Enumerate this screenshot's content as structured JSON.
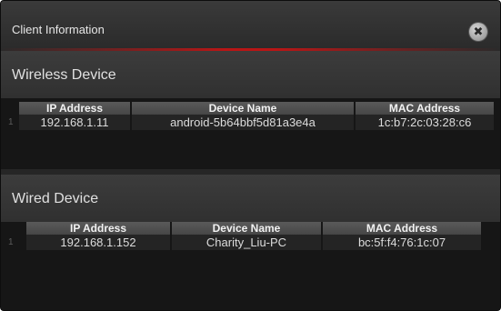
{
  "window": {
    "title": "Client Information"
  },
  "wireless": {
    "title": "Wireless Device",
    "columns": [
      "IP Address",
      "Device Name",
      "MAC Address"
    ],
    "rows": [
      {
        "num": "1",
        "ip": "192.168.1.11",
        "name": "android-5b64bbf5d81a3e4a",
        "mac": "1c:b7:2c:03:28:c6"
      }
    ]
  },
  "wired": {
    "title": "Wired Device",
    "columns": [
      "IP Address",
      "Device Name",
      "MAC Address"
    ],
    "rows": [
      {
        "num": "1",
        "ip": "192.168.1.152",
        "name": "Charity_Liu-PC",
        "mac": "bc:5f:f4:76:1c:07"
      }
    ]
  },
  "icons": {
    "close": "close-icon"
  },
  "colors": {
    "accent_glow": "#c81414",
    "background": "#1f1f1f"
  }
}
